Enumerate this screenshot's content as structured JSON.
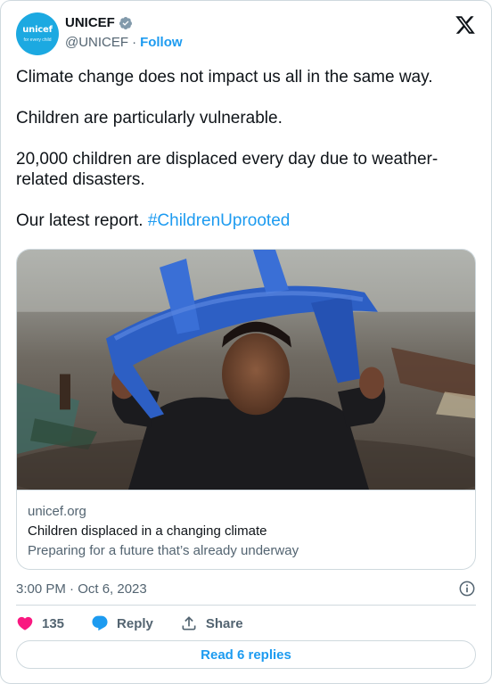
{
  "header": {
    "avatar": {
      "logo_word": "unicef",
      "logo_tag": "for every child"
    },
    "display_name": "UNICEF",
    "verified": true,
    "handle": "@UNICEF",
    "separator": "·",
    "follow_label": "Follow"
  },
  "tweet": {
    "paragraphs": [
      "Climate change does not impact us all in the same way.",
      "Children are particularly vulnerable.",
      "20,000 children are displaced every day due to weather-related disasters."
    ],
    "last_line_prefix": "Our latest report. ",
    "hashtag": "#ChildrenUprooted"
  },
  "link_card": {
    "image_description": "child-holding-blue-chair-over-head-in-rain",
    "domain": "unicef.org",
    "title": "Children displaced in a changing climate",
    "description": "Preparing for a future that’s already underway"
  },
  "meta": {
    "timestamp": "3:00 PM · Oct 6, 2023"
  },
  "actions": {
    "likes_count": "135",
    "reply_label": "Reply",
    "share_label": "Share"
  },
  "footer": {
    "read_replies_label": "Read 6 replies"
  },
  "colors": {
    "accent": "#1d9bf0",
    "like_red": "#f91880",
    "muted": "#536471",
    "border": "#cfd9de",
    "unicef_blue": "#1ca9e1",
    "chair_blue": "#2d5fc4"
  }
}
